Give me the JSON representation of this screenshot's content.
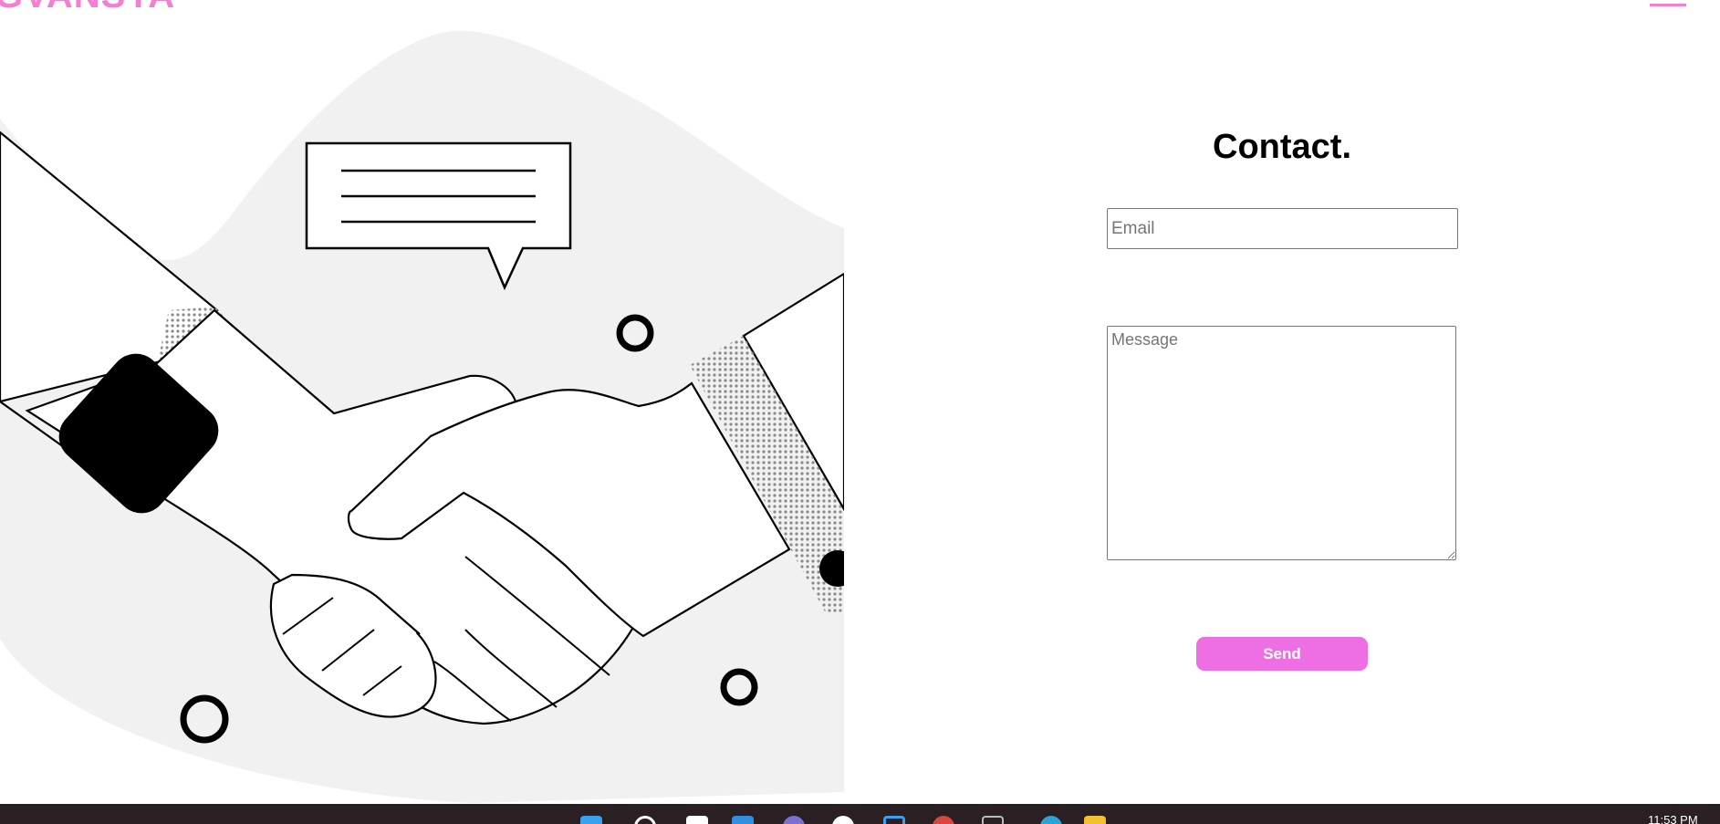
{
  "brand": {
    "logo_text": "GVANSYA",
    "accent": "#f47fd2"
  },
  "nav": {
    "menu_icon": "hamburger-menu-icon"
  },
  "contact": {
    "title": "Contact.",
    "email_placeholder": "Email",
    "message_placeholder": "Message",
    "send_label": "Send",
    "button_color": "#ee6fe3"
  },
  "taskbar": {
    "clock": "11:53 PM",
    "icons": [
      "windows-start-icon",
      "search-icon",
      "task-view-icon",
      "widgets-icon",
      "teams-chat-icon",
      "chrome-icon",
      "store-icon",
      "app-red-icon",
      "app-gray-icon",
      "edge-icon",
      "file-explorer-icon"
    ]
  }
}
